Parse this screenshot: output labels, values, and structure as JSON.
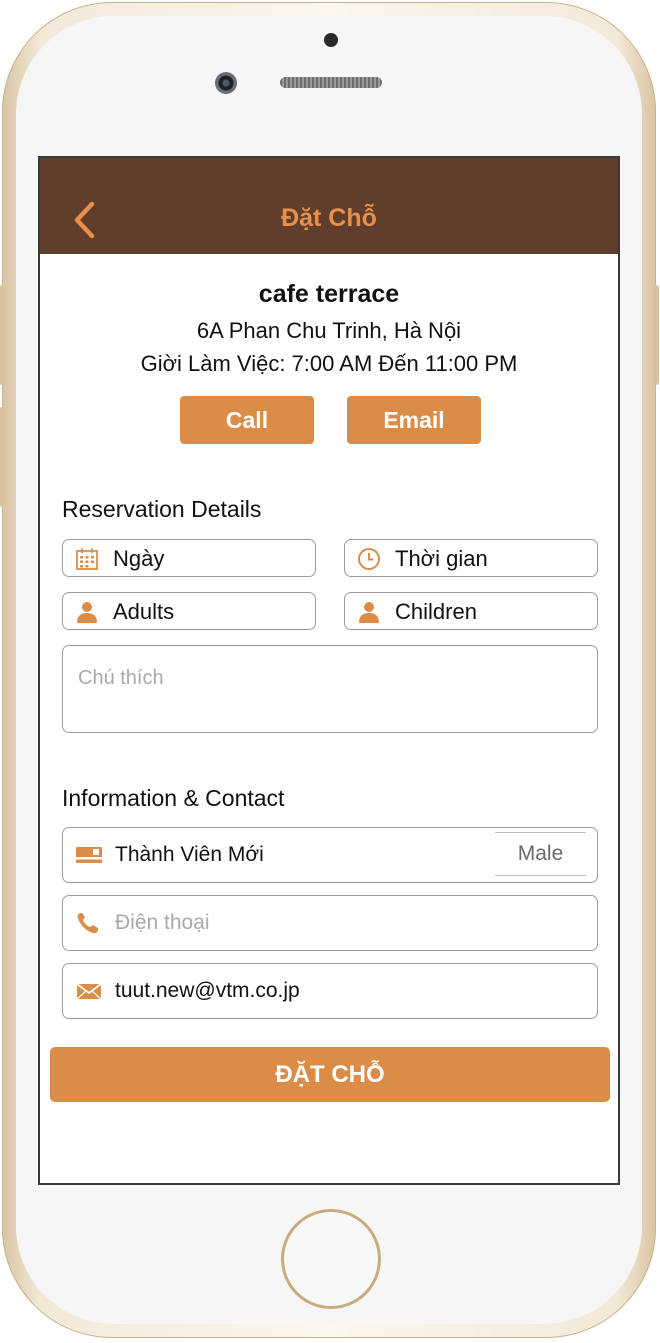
{
  "navbar": {
    "title": "Đặt Chỗ"
  },
  "venue": {
    "name": "cafe terrace",
    "address": "6A Phan Chu Trinh, Hà Nội",
    "hours": "Giời Làm Việc: 7:00 AM Đến 11:00 PM",
    "call_label": "Call",
    "email_label": "Email"
  },
  "reservation": {
    "title": "Reservation Details",
    "date_label": "Ngày",
    "time_label": "Thời gian",
    "adults_label": "Adults",
    "children_label": "Children",
    "note_placeholder": "Chú thích"
  },
  "contact": {
    "title": "Information & Contact",
    "member_name": "Thành Viên Mới",
    "gender": "Male",
    "phone_placeholder": "Điện thoại",
    "email_value": "tuut.new@vtm.co.jp"
  },
  "submit_label": "ĐẶT CHỖ",
  "colors": {
    "accent": "#db8d48",
    "navbar": "#603e2b",
    "title": "#e8904a"
  },
  "icons": [
    "back-chevron-icon",
    "calendar-icon",
    "clock-icon",
    "person-icon",
    "member-card-icon",
    "phone-icon",
    "mail-icon"
  ]
}
